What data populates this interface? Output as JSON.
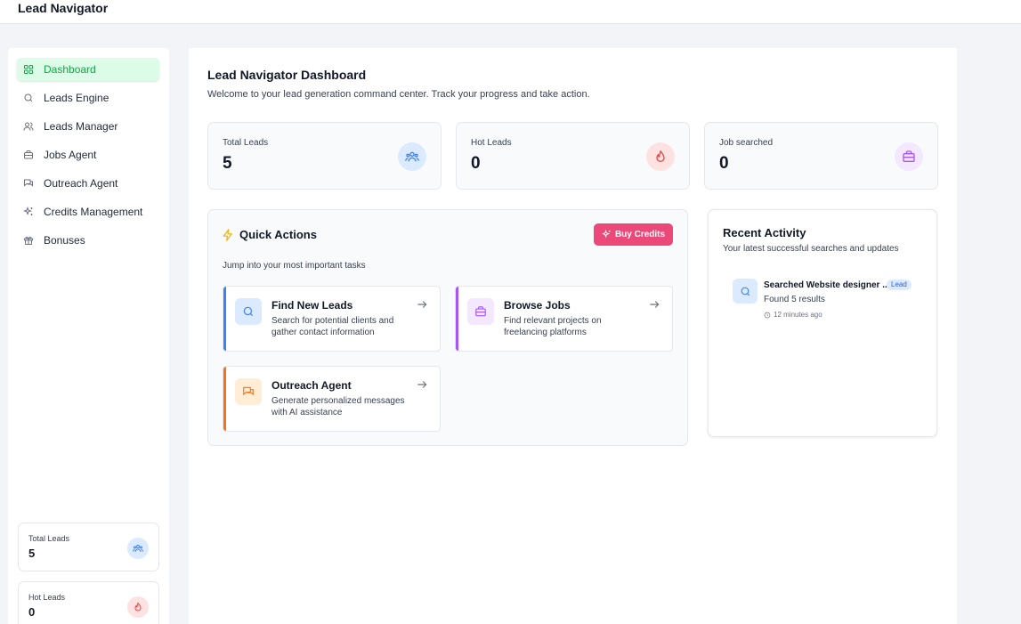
{
  "app": {
    "title": "Lead Navigator"
  },
  "sidebar": {
    "items": [
      {
        "label": "Dashboard",
        "icon": "grid-icon"
      },
      {
        "label": "Leads Engine",
        "icon": "search-icon"
      },
      {
        "label": "Leads Manager",
        "icon": "users-icon"
      },
      {
        "label": "Jobs Agent",
        "icon": "briefcase-icon"
      },
      {
        "label": "Outreach Agent",
        "icon": "chat-icon"
      },
      {
        "label": "Credits Management",
        "icon": "sparkles-icon"
      },
      {
        "label": "Bonuses",
        "icon": "gift-icon"
      }
    ],
    "stats": [
      {
        "label": "Total Leads",
        "value": "5"
      },
      {
        "label": "Hot Leads",
        "value": "0"
      }
    ]
  },
  "header": {
    "title": "Lead Navigator Dashboard",
    "subtitle": "Welcome to your lead generation command center. Track your progress and take action."
  },
  "stats": [
    {
      "label": "Total Leads",
      "value": "5",
      "icon": "users-icon",
      "color": "#3b82f6"
    },
    {
      "label": "Hot Leads",
      "value": "0",
      "icon": "flame-icon",
      "color": "#ef4444"
    },
    {
      "label": "Job searched",
      "value": "0",
      "icon": "briefcase-icon",
      "color": "#a855f7"
    }
  ],
  "quick_actions": {
    "title": "Quick Actions",
    "subtitle": "Jump into your most important tasks",
    "buy_label": "Buy Credits",
    "cards": [
      {
        "title": "Find New Leads",
        "desc": "Search for potential clients and gather contact information",
        "color": "#3b82f6"
      },
      {
        "title": "Browse Jobs",
        "desc": "Find relevant projects on freelancing platforms",
        "color": "#a855f7"
      },
      {
        "title": "Outreach Agent",
        "desc": "Generate personalized messages with AI assistance",
        "color": "#f97316"
      }
    ]
  },
  "recent": {
    "title": "Recent Activity",
    "subtitle": "Your latest successful searches and updates",
    "items": [
      {
        "title": "Searched Website designer ...",
        "badge": "Lead",
        "result": "Found 5 results",
        "time": "12 minutes ago"
      }
    ]
  },
  "colors": {
    "accent": "#16a34a",
    "buy": "#ec4879"
  }
}
